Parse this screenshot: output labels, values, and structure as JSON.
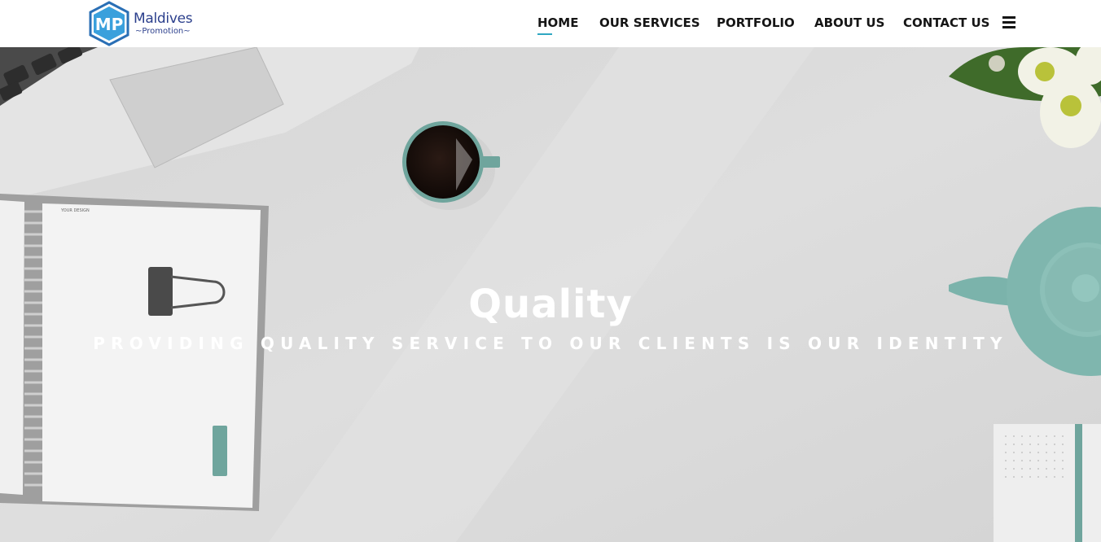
{
  "brand": {
    "logo_letters": "MP",
    "name": "Maldives",
    "tagline": "Promotion",
    "color": "#2b3f8c",
    "accent": "#2fa7c2"
  },
  "nav": {
    "items": [
      {
        "label": "HOME",
        "active": true
      },
      {
        "label": "OUR SERVICES",
        "active": false
      },
      {
        "label": "PORTFOLIO",
        "active": false
      },
      {
        "label": "ABOUT US",
        "active": false
      },
      {
        "label": "CONTACT US",
        "active": false
      }
    ],
    "menu_icon": "hamburger-icon"
  },
  "hero": {
    "title": "Quality",
    "subtitle": "PROVIDING QUALITY SERVICE TO OUR CLIENTS IS OUR IDENTITY",
    "background": "#d9d9d9",
    "notebook_label": "YOUR DESIGN"
  }
}
